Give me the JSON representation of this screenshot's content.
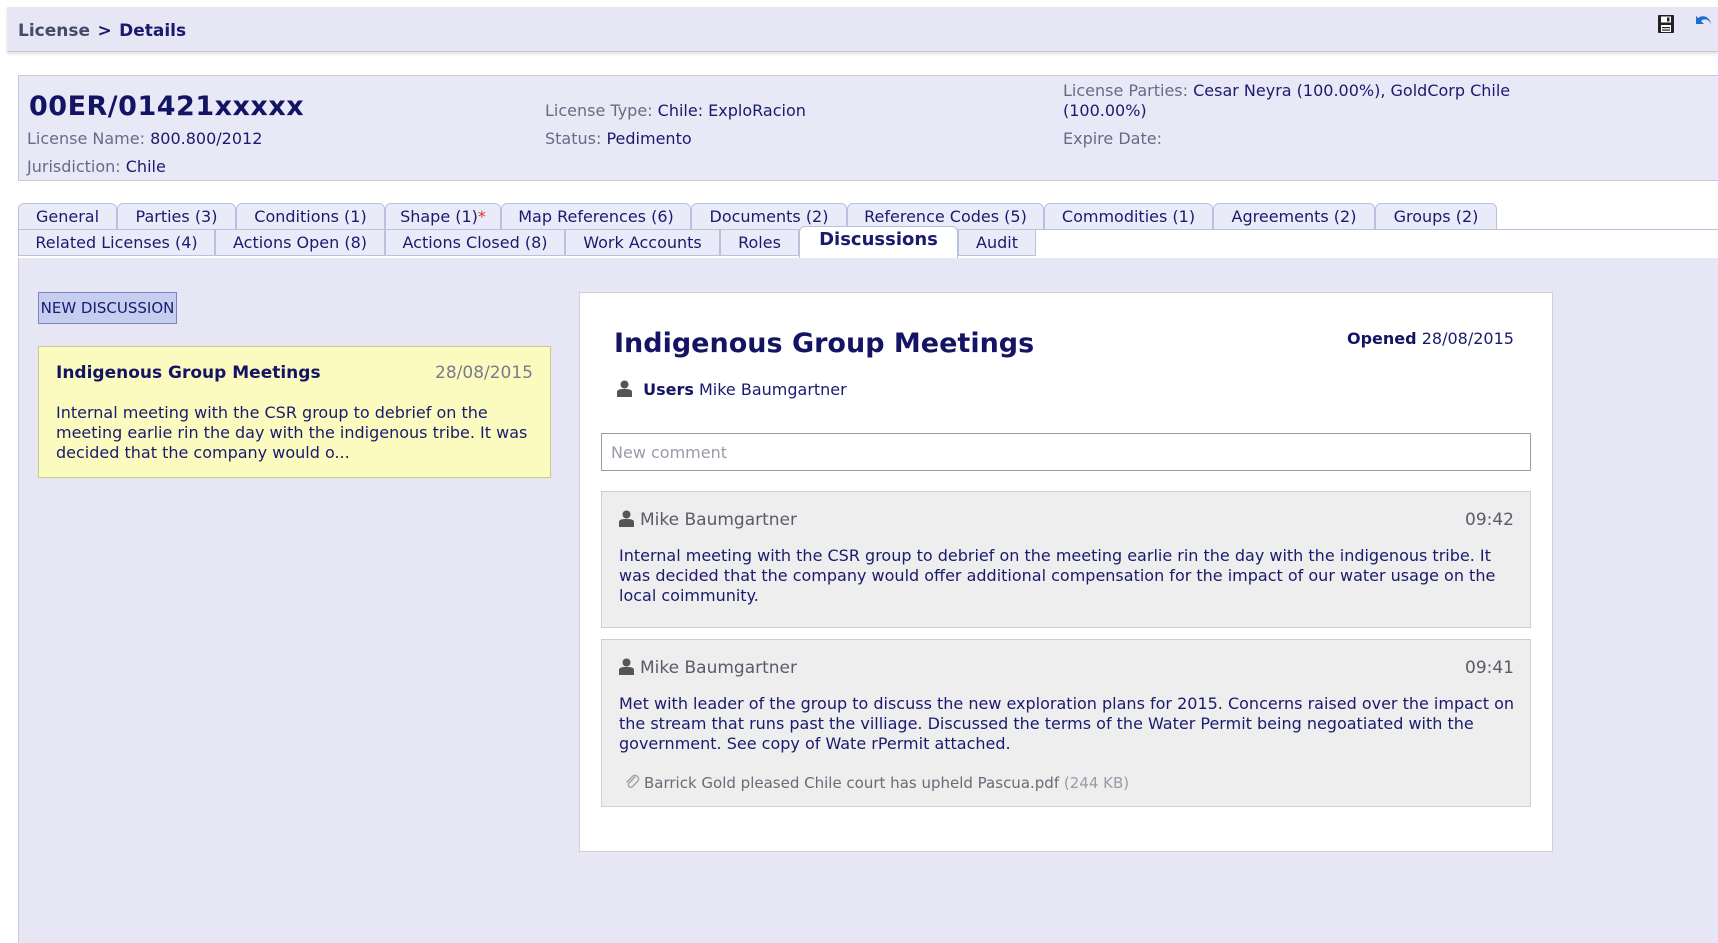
{
  "breadcrumb": {
    "root": "License",
    "separator": ">",
    "current": "Details"
  },
  "toolbar": {
    "save_icon": "save-icon",
    "undo_icon": "undo-icon"
  },
  "license": {
    "id": "00ER/01421xxxxx",
    "name_label": "License Name:",
    "name": "800.800/2012",
    "jurisdiction_label": "Jurisdiction:",
    "jurisdiction": "Chile",
    "type_label": "License Type:",
    "type": "Chile: ExploRacion",
    "status_label": "Status:",
    "status": "Pedimento",
    "parties_label": "License Parties:",
    "parties_line1": "Cesar Neyra (100.00%), GoldCorp Chile",
    "parties_line2": "(100.00%)",
    "expire_label": "Expire Date:",
    "expire": ""
  },
  "tabs": {
    "row1": [
      {
        "label": "General"
      },
      {
        "label": "Parties (3)"
      },
      {
        "label": "Conditions (1)"
      },
      {
        "label": "Shape (1)",
        "marker": "*"
      },
      {
        "label": "Map References (6)"
      },
      {
        "label": "Documents (2)"
      },
      {
        "label": "Reference Codes (5)"
      },
      {
        "label": "Commodities (1)"
      },
      {
        "label": "Agreements (2)"
      },
      {
        "label": "Groups (2)"
      }
    ],
    "row2": [
      {
        "label": "Related Licenses (4)"
      },
      {
        "label": "Actions Open (8)"
      },
      {
        "label": "Actions Closed (8)"
      },
      {
        "label": "Work Accounts"
      },
      {
        "label": "Roles"
      },
      {
        "label": "Discussions",
        "active": true
      },
      {
        "label": "Audit"
      }
    ]
  },
  "discussions": {
    "new_button": "NEW DISCUSSION",
    "list": [
      {
        "title": "Indigenous Group Meetings",
        "date": "28/08/2015",
        "snippet": "Internal meeting with the CSR group to debrief on the meeting earlie rin the day with the indigenous tribe. It was decided that the company would o..."
      }
    ]
  },
  "detail": {
    "title": "Indigenous Group Meetings",
    "opened_label": "Opened",
    "opened_date": "28/08/2015",
    "users_label": "Users",
    "users": "Mike Baumgartner",
    "comment_placeholder": "New comment",
    "comments": [
      {
        "author": "Mike Baumgartner",
        "time": "09:42",
        "text": "Internal meeting with the CSR group to debrief on the meeting earlie rin the day with the indigenous tribe. It was decided that the company would offer additional compensation for the impact of our water usage on the local coimmunity."
      },
      {
        "author": "Mike Baumgartner",
        "time": "09:41",
        "text": "Met with leader of the group to discuss the new exploration plans for 2015. Concerns raised over the impact on the stream that runs past the villiage. Discussed the terms of the Water Permit being negoatiated with the government. See copy of Wate rPermit attached.",
        "attachment": {
          "name": "Barrick Gold pleased Chile court has upheld Pascua.pdf",
          "size": "(244 KB)"
        }
      }
    ]
  },
  "colors": {
    "accent": "#1a1a6e",
    "header_bg": "#e8e8f6",
    "card_bg": "#fbfbc0",
    "required": "#e0322a"
  }
}
